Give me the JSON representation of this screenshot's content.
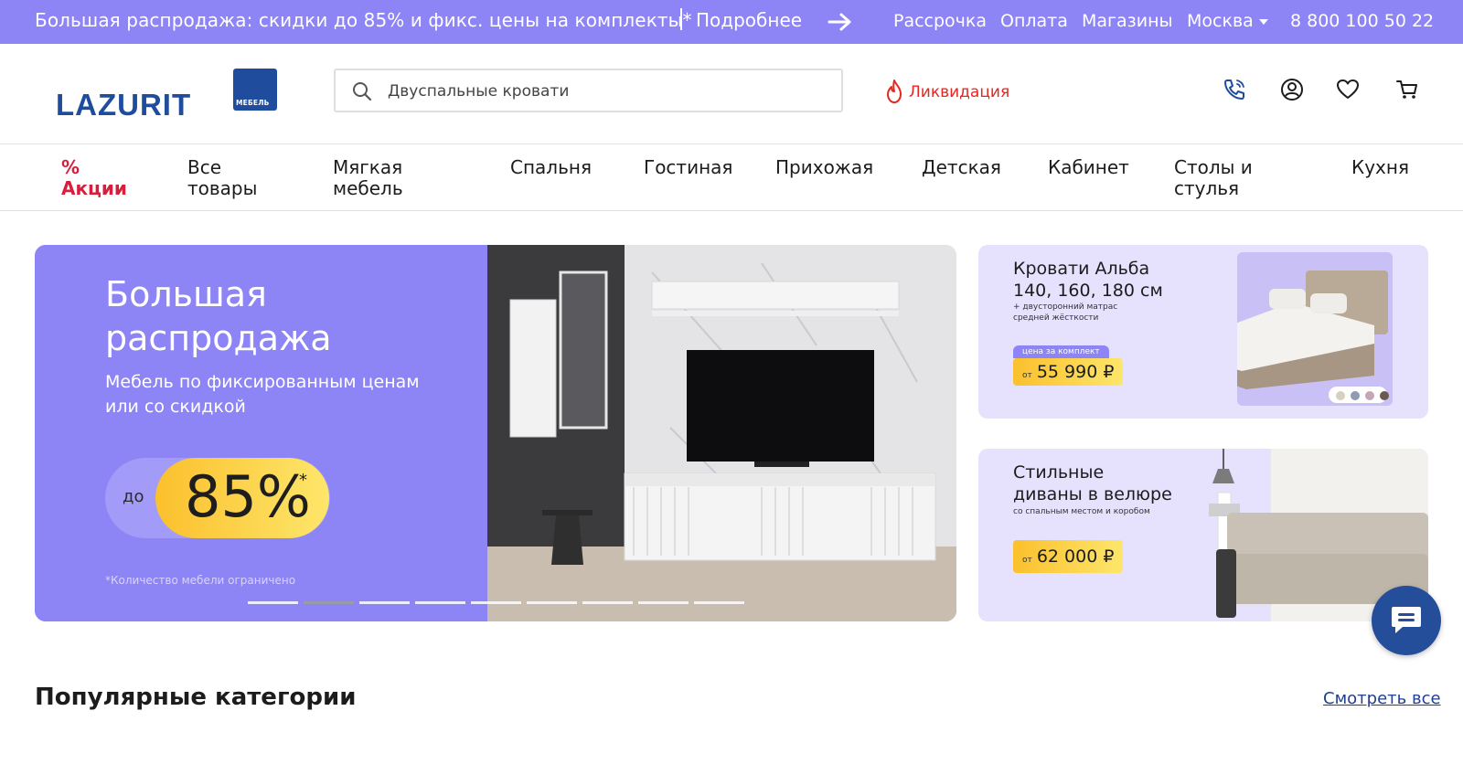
{
  "topbar": {
    "promo": "Большая распродажа: скидки до 85% и фикс. цены на комплекты*",
    "more": "Подробнее",
    "links": [
      "Рассрочка",
      "Оплата",
      "Магазины"
    ],
    "city": "Москва",
    "phone": "8 800 100 50 22",
    "bg_color": "#8d84f6"
  },
  "header": {
    "logo": "LAZURIT",
    "logo_badge": "МЕБЕЛЬ",
    "search_value": "Двуспальные кровати",
    "liquidation": "Ликвидация",
    "icons": [
      "phone-icon",
      "user-icon",
      "heart-icon",
      "cart-icon"
    ]
  },
  "nav": {
    "sale": "Акции",
    "sale_symbol": "%",
    "items": [
      "Все товары",
      "Мягкая мебель",
      "Спальня",
      "Гостиная",
      "Прихожая",
      "Детская",
      "Кабинет",
      "Столы и стулья",
      "Кухня"
    ]
  },
  "hero": {
    "title": "Большая распродажа",
    "subtitle": "Мебель по фиксированным ценам или со скидкой",
    "prefix": "до",
    "discount": "85%",
    "star": "*",
    "footnote": "*Количество мебели ограничено",
    "slides_count": 9,
    "active_slide": 2
  },
  "banner1": {
    "title": "Кровати Альба 140, 160, 180 см",
    "note": "+ двусторонний матрас средней жёсткости",
    "tag": "цена за комплект",
    "from": "от",
    "price": "55 990 ₽",
    "color_swatches": [
      "#d8cfc2",
      "#8f9bb0",
      "#c4a7b3",
      "#6b5a4e"
    ]
  },
  "banner2": {
    "title": "Стильные диваны в велюре",
    "note": "со спальным местом и коробом",
    "from": "от",
    "price": "62 000 ₽"
  },
  "section": {
    "title": "Популярные категории",
    "see_all": "Смотреть все"
  },
  "colors": {
    "accent": "#8d84f6",
    "brand": "#1f4c9c",
    "sale_red": "#d81e3d",
    "liquidation_red": "#e8251f",
    "price_yellow": "#fbc02d"
  }
}
